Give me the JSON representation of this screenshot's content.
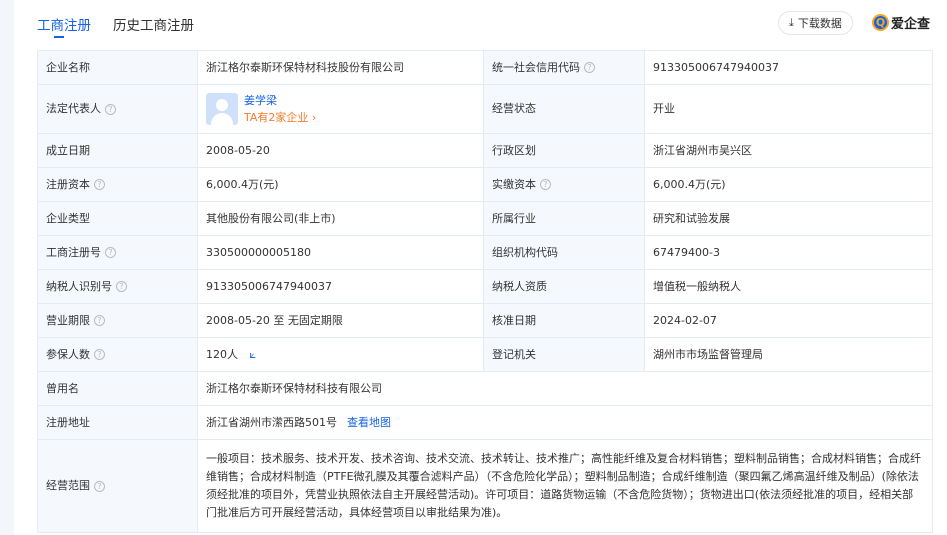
{
  "tabs": [
    "工商注册",
    "历史工商注册"
  ],
  "download_label": "下载数据",
  "logo_text": "爱企查",
  "rows": {
    "name_k": "企业名称",
    "name_v": "浙江格尔泰斯环保特材科技股份有限公司",
    "credit_k": "统一社会信用代码",
    "credit_v": "913305006747940037",
    "legal_k": "法定代表人",
    "legal_name": "姜学梁",
    "legal_link": "TA有2家企业 ›",
    "status_k": "经营状态",
    "status_v": "开业",
    "est_k": "成立日期",
    "est_v": "2008-05-20",
    "region_k": "行政区划",
    "region_v": "浙江省湖州市吴兴区",
    "capital_k": "注册资本",
    "capital_v": "6,000.4万(元)",
    "paid_k": "实缴资本",
    "paid_v": "6,000.4万(元)",
    "type_k": "企业类型",
    "type_v": "其他股份有限公司(非上市)",
    "industry_k": "所属行业",
    "industry_v": "研究和试验发展",
    "regno_k": "工商注册号",
    "regno_v": "330500000005180",
    "org_k": "组织机构代码",
    "org_v": "67479400-3",
    "tax_k": "纳税人识别号",
    "tax_v": "913305006747940037",
    "taxq_k": "纳税人资质",
    "taxq_v": "增值税一般纳税人",
    "term_k": "营业期限",
    "term_v": "2008-05-20 至 无固定期限",
    "approve_k": "核准日期",
    "approve_v": "2024-02-07",
    "insured_k": "参保人数",
    "insured_v": "120人",
    "authority_k": "登记机关",
    "authority_v": "湖州市市场监督管理局",
    "former_k": "曾用名",
    "former_v": "浙江格尔泰斯环保特材科技有限公司",
    "addr_k": "注册地址",
    "addr_v": "浙江省湖州市潆西路501号",
    "addr_link": "查看地图",
    "scope_k": "经营范围",
    "scope_v": "一般项目：技术服务、技术开发、技术咨询、技术交流、技术转让、技术推广；高性能纤维及复合材料销售；塑料制品销售；合成材料销售；合成纤维销售；合成材料制造（PTFE微孔膜及其覆合滤料产品）（不含危险化学品）；塑料制品制造；合成纤维制造（聚四氟乙烯高温纤维及制品）(除依法须经批准的项目外，凭营业执照依法自主开展经营活动)。许可项目：道路货物运输（不含危险货物）；货物进出口(依法须经批准的项目，经相关部门批准后方可开展经营活动，具体经营项目以审批结果为准)。"
  }
}
